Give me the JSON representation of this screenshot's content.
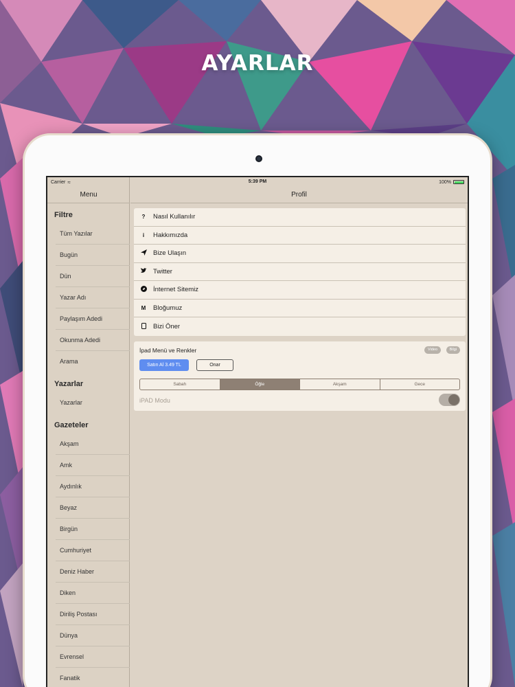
{
  "hero": {
    "title": "AYARLAR"
  },
  "status_bar": {
    "carrier": "Carrier",
    "time": "5:39 PM",
    "battery": "100%"
  },
  "sidebar": {
    "header": "Menu",
    "sections": [
      {
        "title": "Filtre",
        "items": [
          "Tüm Yazılar",
          "Bugün",
          "Dün",
          "Yazar Adı",
          "Paylaşım Adedi",
          "Okunma Adedi",
          "Arama"
        ]
      },
      {
        "title": "Yazarlar",
        "items": [
          "Yazarlar"
        ]
      },
      {
        "title": "Gazeteler",
        "items": [
          "Akşam",
          "Amk",
          "Aydınlık",
          "Beyaz",
          "Birgün",
          "Cumhuriyet",
          "Deniz Haber",
          "Diken",
          "Diriliş Postası",
          "Dünya",
          "Evrensel",
          "Fanatik"
        ]
      }
    ]
  },
  "main": {
    "header": "Profil",
    "menu_items": [
      {
        "label": "Nasıl Kullanılır",
        "icon": "question-icon"
      },
      {
        "label": "Hakkımızda",
        "icon": "info-icon"
      },
      {
        "label": "Bize Ulaşın",
        "icon": "paper-plane-icon"
      },
      {
        "label": "Twitter",
        "icon": "twitter-icon"
      },
      {
        "label": "İnternet Sitemiz",
        "icon": "compass-icon"
      },
      {
        "label": "Bloğumuz",
        "icon": "medium-icon"
      },
      {
        "label": "Bizi Öner",
        "icon": "tablet-icon"
      }
    ],
    "ipad": {
      "title": "İpad Menü ve Renkler",
      "video_label": "Video",
      "info_label": "Bilgi",
      "buy_label": "Satın Al 3.49 TL",
      "restore_label": "Onar",
      "segments": [
        "Sabah",
        "Öğle",
        "Akşam",
        "Gece"
      ],
      "active_segment": "Öğle",
      "mode_label": "iPAD Modu",
      "mode_on": true
    }
  }
}
